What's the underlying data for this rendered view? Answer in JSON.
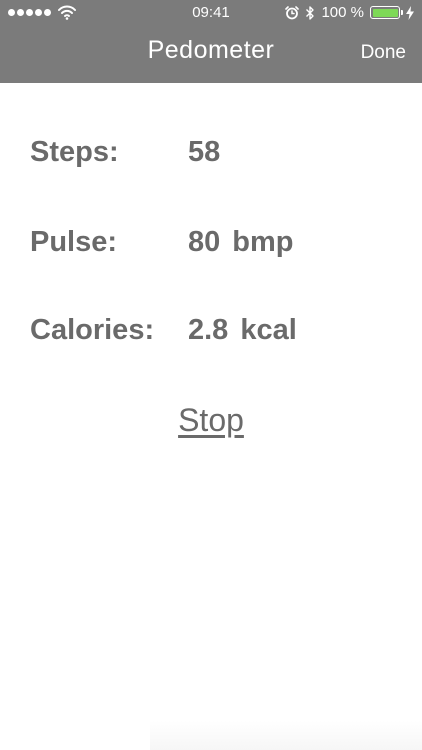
{
  "status_bar": {
    "time": "09:41",
    "battery_percent": "100 %",
    "icons": [
      "signal-dots-icon",
      "wifi-icon",
      "alarm-icon",
      "bluetooth-icon",
      "battery-icon",
      "charging-bolt-icon"
    ],
    "battery_fill": 1.0,
    "battery_color": "#7ed957"
  },
  "nav": {
    "title": "Pedometer",
    "done_label": "Done",
    "background_color": "#7b7b7b"
  },
  "stats": {
    "steps": {
      "label": "Steps:",
      "value": "58"
    },
    "pulse": {
      "label": "Pulse:",
      "value": "80",
      "unit": "bmp"
    },
    "calories": {
      "label": "Calories:",
      "value": "2.8",
      "unit": "kcal"
    }
  },
  "actions": {
    "stop_label": "Stop"
  }
}
